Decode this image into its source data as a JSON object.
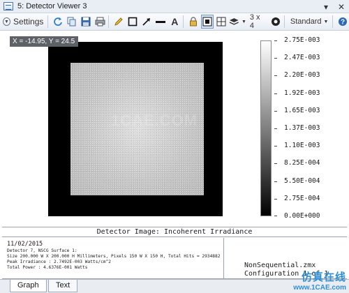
{
  "window": {
    "title": "5: Detector Viewer 3",
    "controls": {
      "dropdown": "▾",
      "close": "✕",
      "help": "?"
    }
  },
  "toolbar": {
    "settings_label": "Settings",
    "layout_label": "3 x 4",
    "mode_label": "Standard",
    "text_tool_label": "A",
    "icons": [
      "refresh-icon",
      "copy-icon",
      "save-icon",
      "print-icon",
      "pencil-icon",
      "rectangle-icon",
      "arrow-icon",
      "line-icon",
      "text-icon",
      "lock-icon",
      "fit-icon",
      "grid-icon",
      "layers-icon",
      "layout-icon",
      "settings-gear-icon"
    ]
  },
  "coordinate_readout": "X = -14.95, Y = 24.5",
  "image": {
    "watermark_text": "1CAE.COM"
  },
  "colorbar": {
    "labels": [
      "2.75E-003",
      "2.47E-003",
      "2.20E-003",
      "1.92E-003",
      "1.65E-003",
      "1.37E-003",
      "1.10E-003",
      "8.25E-004",
      "5.50E-004",
      "2.75E-004",
      "0.00E+000"
    ],
    "top_color": "#ffffff",
    "bottom_color": "#000000"
  },
  "caption": "Detector Image: Incoherent Irradiance",
  "info": {
    "date": "11/02/2015",
    "lines": [
      "Detector 7, NSCG Surface 1:",
      "Size 200.000 W X 200.000 H Millimeters, Pixels 150 W X 150 H, Total Hits = 2934882",
      "Peak Irradiance : 2.7492E-003 Watts/cm^2",
      "Total Power     : 4.6376E-001 Watts"
    ],
    "file": "NonSequential.zmx",
    "config": "Configuration 1 of 1"
  },
  "tabs": [
    {
      "label": "Graph",
      "active": true
    },
    {
      "label": "Text",
      "active": false
    }
  ],
  "watermark": {
    "cn": "仿真在线",
    "url": "www.1CAE.com",
    "color": "#2f8fd6"
  }
}
